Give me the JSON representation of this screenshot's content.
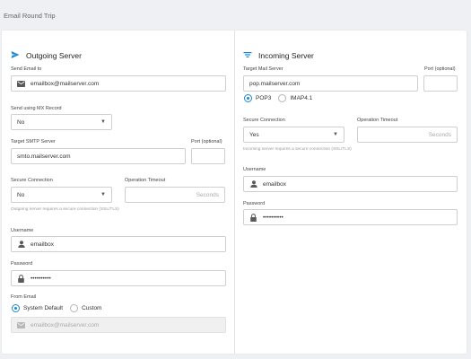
{
  "page": {
    "title": "Email Round Trip"
  },
  "outgoing": {
    "title": "Outgoing Server",
    "send_email_to": {
      "label": "Send Email to",
      "value": "emailbox@mailserver.com"
    },
    "mx_record": {
      "label": "Send using MX Record",
      "value": "No"
    },
    "smtp": {
      "label": "Target SMTP Server",
      "value": "smto.mailserver.com"
    },
    "port": {
      "label": "Port (optional)",
      "value": ""
    },
    "secure": {
      "label": "Secure Connection",
      "value": "No",
      "hint": "Outgoing server requires a secure connection (SSL/TLS)"
    },
    "timeout": {
      "label": "Operation Timeout",
      "unit": "Seconds"
    },
    "username": {
      "label": "Username",
      "value": "emailbox"
    },
    "password": {
      "label": "Password",
      "value": "••••••••••"
    },
    "from_email": {
      "label": "From Email",
      "options": [
        "System Default",
        "Custom"
      ],
      "selected": "System Default",
      "placeholder": "emailbox@mailserver.com"
    }
  },
  "incoming": {
    "title": "Incoming Server",
    "mail_server": {
      "label": "Target Mail Server",
      "value": "pop.mailserver.com"
    },
    "port": {
      "label": "Port (optional)",
      "value": ""
    },
    "protocol": {
      "options": [
        "POP3",
        "IMAP4.1"
      ],
      "selected": "POP3"
    },
    "secure": {
      "label": "Secure Connection",
      "value": "Yes",
      "hint": "Incoming server requires a secure connection (SSL/TLS)"
    },
    "timeout": {
      "label": "Operation Timeout",
      "unit": "Seconds"
    },
    "username": {
      "label": "Username",
      "value": "emailbox"
    },
    "password": {
      "label": "Password",
      "value": "••••••••••"
    }
  },
  "colors": {
    "accent": "#1a87d0",
    "icon": "#5a5a5a"
  }
}
